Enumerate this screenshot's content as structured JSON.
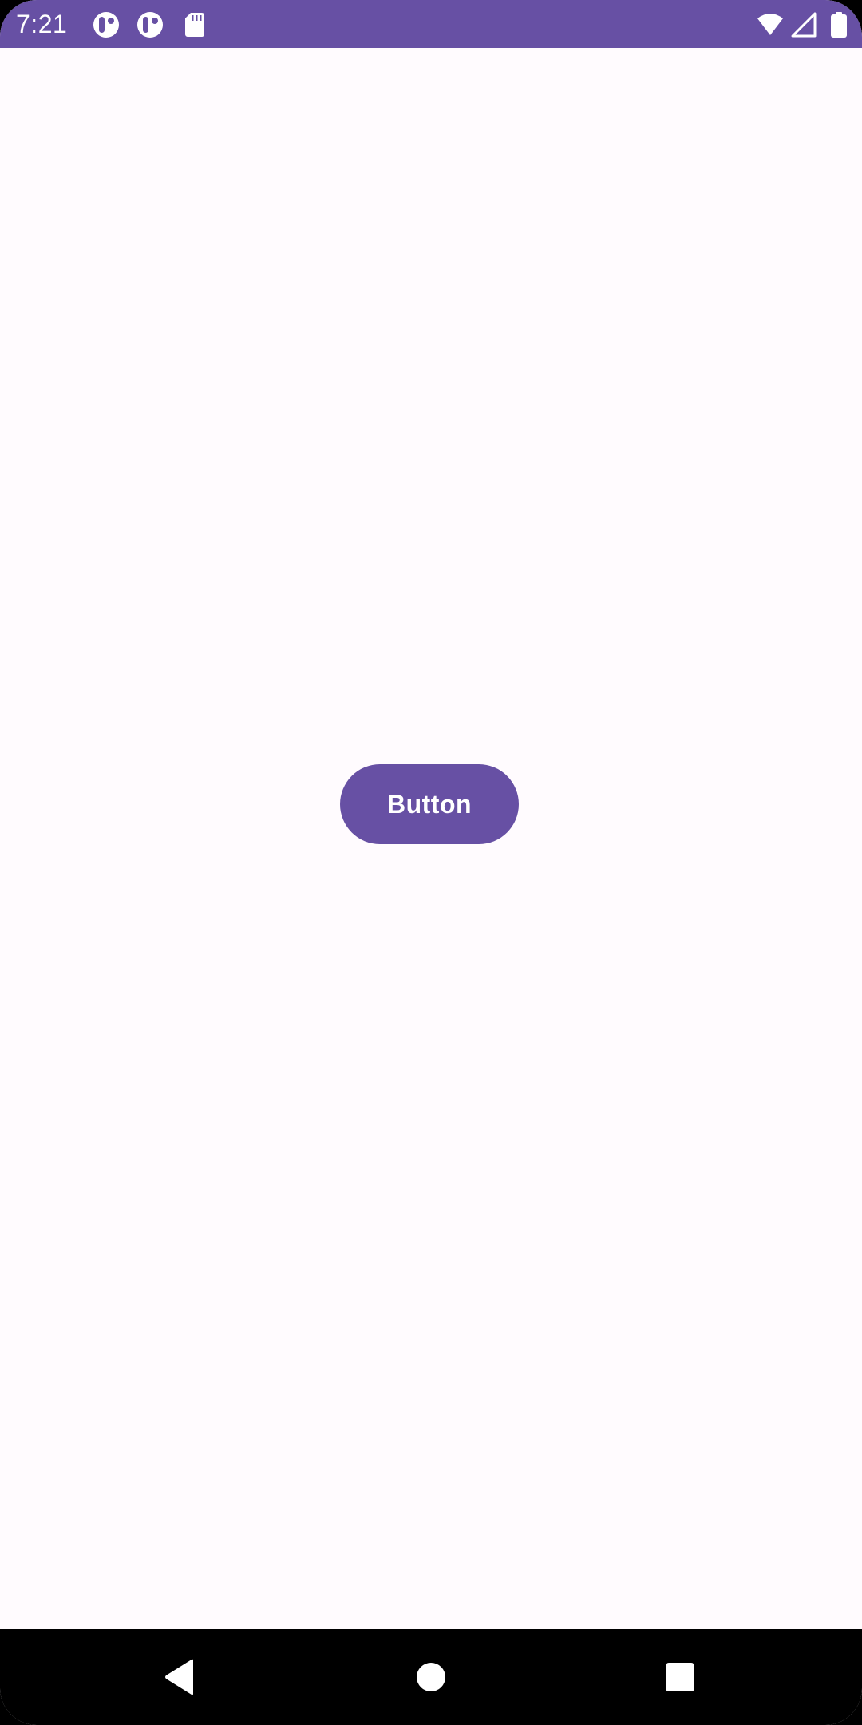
{
  "status_bar": {
    "time": "7:21",
    "background_color": "#6750a4",
    "left_icons": [
      "app-notification-icon",
      "app-notification-icon",
      "sd-card-icon"
    ],
    "right_icons": [
      "wifi-icon",
      "cellular-signal-icon",
      "battery-icon"
    ]
  },
  "main": {
    "button_label": "Button",
    "background_color": "#fffbfe",
    "button_color": "#6750a4"
  },
  "navigation_bar": {
    "buttons": [
      "back-icon",
      "home-icon",
      "recents-icon"
    ]
  }
}
